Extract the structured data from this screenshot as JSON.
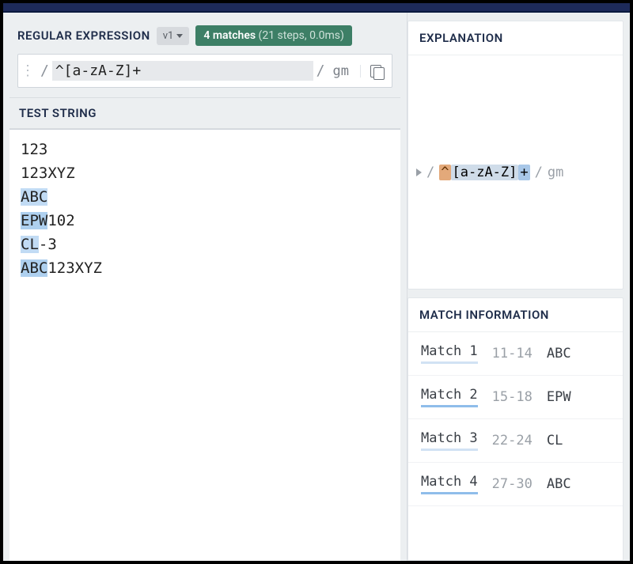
{
  "header": {
    "title": "REGULAR EXPRESSION",
    "version_chip": "v1",
    "match_count": "4 matches",
    "match_detail": "(21 steps, 0.0ms)"
  },
  "regex": {
    "delimiter": "/",
    "pattern": "^[a-zA-Z]+",
    "flags": "gm"
  },
  "test_string_label": "TEST STRING",
  "test_lines": [
    [
      {
        "t": "123",
        "hl": false
      }
    ],
    [
      {
        "t": "123XYZ",
        "hl": false
      }
    ],
    [
      {
        "t": "ABC",
        "hl": true
      }
    ],
    [
      {
        "t": "EPW",
        "hl": true
      },
      {
        "t": "102",
        "hl": false
      }
    ],
    [
      {
        "t": "CL",
        "hl": true
      },
      {
        "t": "-3",
        "hl": false
      }
    ],
    [
      {
        "t": "ABC",
        "hl": true
      },
      {
        "t": "123XYZ",
        "hl": false
      }
    ]
  ],
  "explanation": {
    "title": "EXPLANATION",
    "tokens": {
      "anchor": "^",
      "class": "[a-zA-Z]",
      "quant": "+",
      "flags": "gm"
    }
  },
  "match_info": {
    "title": "MATCH INFORMATION",
    "rows": [
      {
        "label": "Match 1",
        "range": "11-14",
        "text": "ABC"
      },
      {
        "label": "Match 2",
        "range": "15-18",
        "text": "EPW"
      },
      {
        "label": "Match 3",
        "range": "22-24",
        "text": "CL"
      },
      {
        "label": "Match 4",
        "range": "27-30",
        "text": "ABC"
      }
    ]
  }
}
